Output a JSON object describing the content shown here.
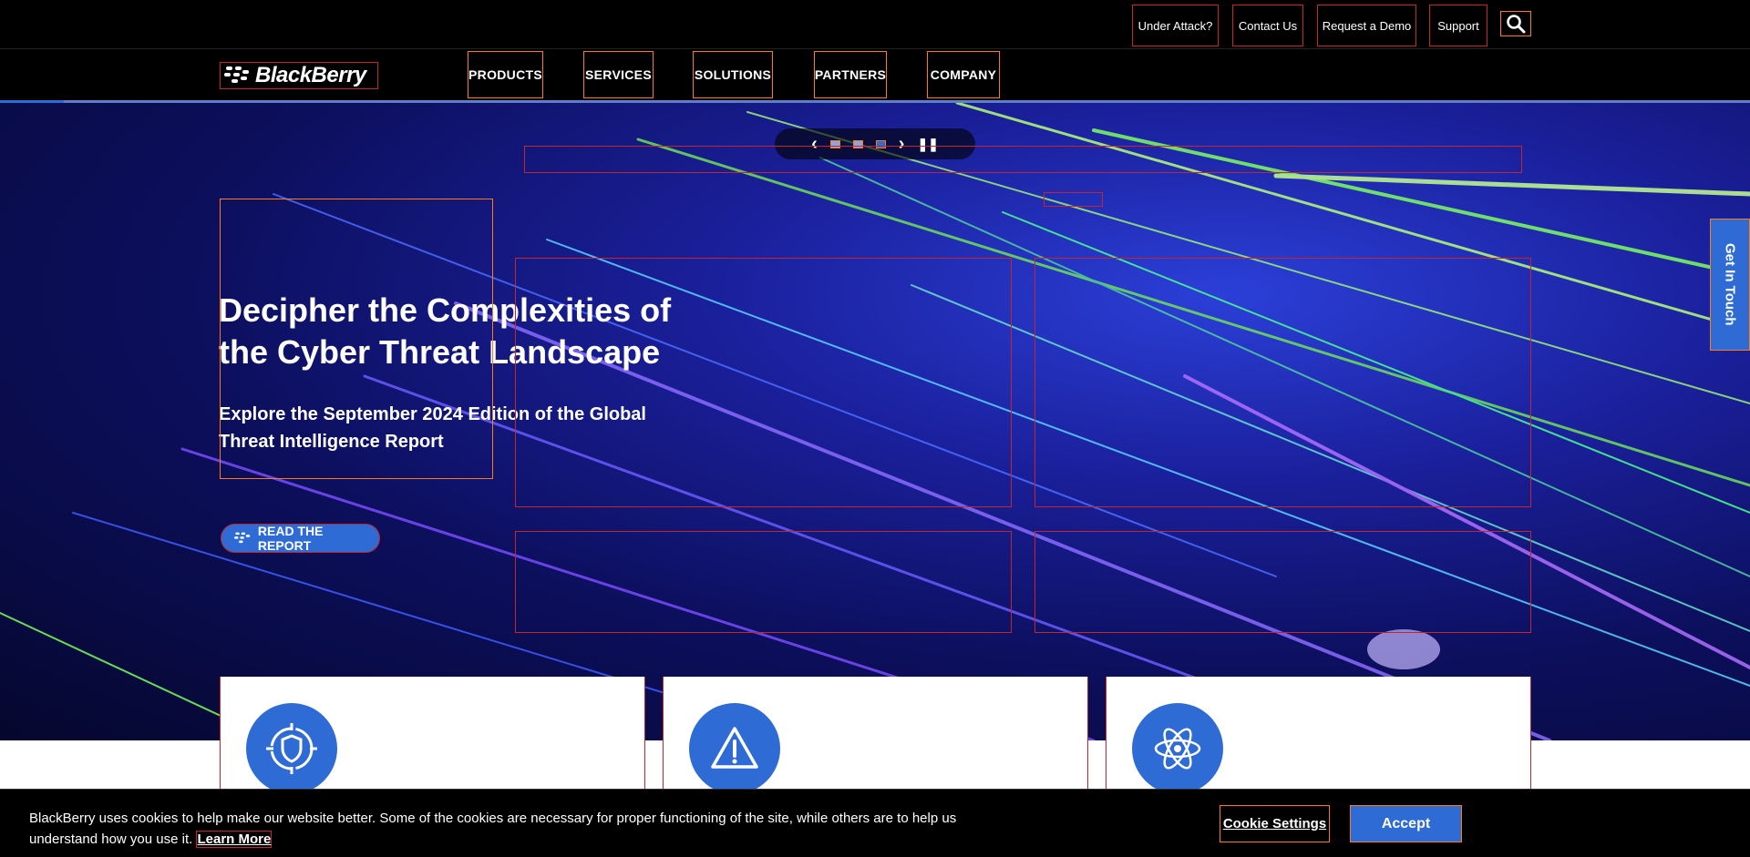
{
  "utility_nav": {
    "under_attack": "Under Attack?",
    "contact_us": "Contact Us",
    "request_demo": "Request a Demo",
    "support": "Support",
    "search_icon": "search-icon"
  },
  "brand": {
    "logo_text": "BlackBerry"
  },
  "main_nav": {
    "items": [
      {
        "label": "PRODUCTS"
      },
      {
        "label": "SERVICES"
      },
      {
        "label": "SOLUTIONS"
      },
      {
        "label": "PARTNERS"
      },
      {
        "label": "COMPANY"
      }
    ]
  },
  "hero": {
    "title": "Decipher the Complexities of the Cyber Threat Landscape",
    "subtitle": "Explore the September 2024 Edition of the Global Threat Intelligence Report",
    "cta_label": "READ THE REPORT",
    "carousel": {
      "slides": 3,
      "active_slide": 3
    }
  },
  "side_tab": {
    "label": "Get In Touch"
  },
  "cards": [
    {
      "icon": "shield-target-icon"
    },
    {
      "icon": "warning-triangle-icon"
    },
    {
      "icon": "atom-icon"
    }
  ],
  "cookie_banner": {
    "text": "BlackBerry uses cookies to help make our website better. Some of the cookies are necessary for proper functioning of the site, while others are to help us understand how you use it.",
    "learn_more": "Learn More",
    "settings_label": "Cookie Settings",
    "accept_label": "Accept"
  },
  "colors": {
    "brand_blue": "#2f6bd4",
    "background_dark": "#000000",
    "hero_deep": "#0c0f5c"
  }
}
